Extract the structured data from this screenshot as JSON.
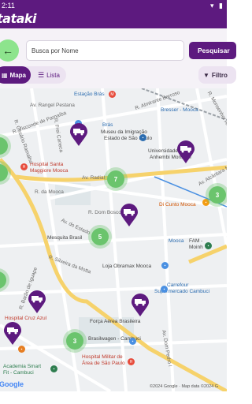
{
  "status": {
    "time": "2:11",
    "icons": "▾ ▮"
  },
  "app": {
    "brand": "tataki"
  },
  "search": {
    "placeholder": "Busca por Nome",
    "button_label": "Pesquisar"
  },
  "view_toggle": {
    "map_label": "Mapa",
    "list_label": "Lista",
    "selected": "Mapa"
  },
  "filter": {
    "label": "Filtro"
  },
  "map": {
    "labels": [
      "Estação Brás",
      "Av. Rangel Pestana",
      "Bresser - Mooca",
      "Museu da Imigração",
      "Estado de São Paulo",
      "Brás",
      "Universidade",
      "Anhembi Morumbi",
      "Hospital Santa",
      "Maggiore Mooca",
      "Av. Radial",
      "Di Cunto Mooca",
      "R. da Mooca",
      "Mesquita Brasil",
      "Mooca",
      "FAM -",
      "Moinh",
      "Loja Obramax Mooca",
      "Carrefour",
      "Supermercado Cambuci",
      "Hospital Cruz Azul",
      "Força Aérea Brasileira",
      "Brasilwagen - Cambuci",
      "Hospital Militar de",
      "Área de São Paulo",
      "Academia Smart",
      "Fit - Cambuci",
      "R. Visconde de Parnaíba",
      "R. Dom Bosco",
      "R. Almirante Barroso",
      "R. Monsenhor Andrade",
      "Av. Alcântara Machado",
      "R. Silveira da Motta",
      "Av. do Estado",
      "R. Cesário Ramalho",
      "R. Barão de Iguape",
      "Av. Dom Pedro I",
      "R. Frei Caneca",
      "Estação Brás"
    ],
    "clusters": [
      "7",
      "5",
      "3",
      "3"
    ],
    "attribution": "©2024 Google · Map data ©2024 G",
    "google_logo": "Google"
  },
  "colors": {
    "brand": "#5d1a7f",
    "cluster": "#6bc46d",
    "back_button": "#8de48d"
  }
}
